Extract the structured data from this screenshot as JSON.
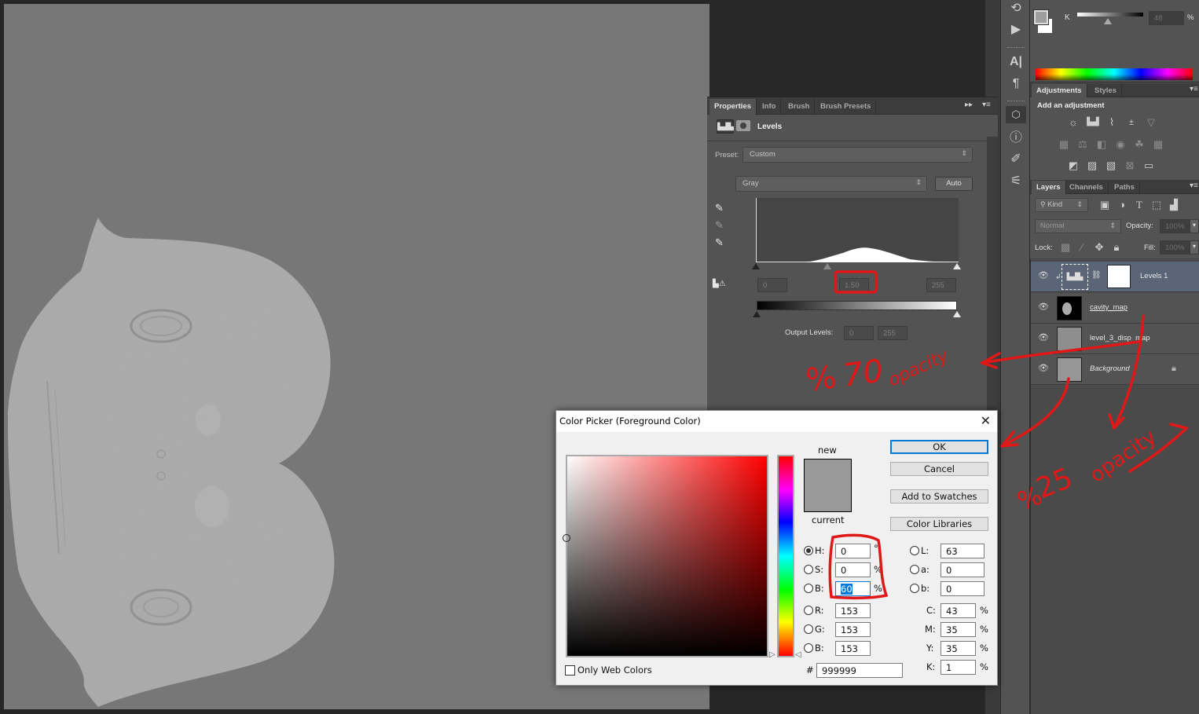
{
  "canvas": {
    "document_description": "Grayscale head displacement/cavity UV map"
  },
  "toolbar_strip": {
    "icons": [
      "history-icon",
      "play-action-icon",
      "character-icon",
      "paragraph-icon",
      "3d-properties-icon",
      "info-icon",
      "brush-presets-icon",
      "tool-presets-icon"
    ]
  },
  "color_panel": {
    "channel_label": "K",
    "k_value": "48",
    "percent": "%",
    "slider_value_percent": 48
  },
  "adjustments_panel": {
    "tabs": [
      "Adjustments",
      "Styles"
    ],
    "active_tab": "Adjustments",
    "heading": "Add an adjustment",
    "icons_row1": [
      "brightness-contrast-icon",
      "levels-icon",
      "curves-icon",
      "exposure-icon",
      "vibrance-icon"
    ],
    "icons_row2": [
      "hue-saturation-icon",
      "color-balance-icon",
      "black-white-icon",
      "photo-filter-icon",
      "channel-mixer-icon",
      "color-lookup-icon"
    ],
    "icons_row3": [
      "invert-icon",
      "posterize-icon",
      "threshold-icon",
      "selective-color-icon",
      "gradient-map-icon"
    ]
  },
  "layers_panel": {
    "tabs": [
      "Layers",
      "Channels",
      "Paths"
    ],
    "active_tab": "Layers",
    "filter_label": "Kind",
    "blend_mode": "Normal",
    "opacity_label": "Opacity:",
    "opacity_value": "100%",
    "lock_label": "Lock:",
    "fill_label": "Fill:",
    "fill_value": "100%",
    "layers": [
      {
        "name": "Levels 1",
        "type": "adjustment",
        "selected": true,
        "visible": true
      },
      {
        "name": "cavity_map",
        "type": "raster",
        "selected": false,
        "visible": true
      },
      {
        "name": "level_3_disp_map",
        "type": "raster",
        "selected": false,
        "visible": true
      },
      {
        "name": "Background",
        "type": "background",
        "selected": false,
        "visible": true,
        "locked": true
      }
    ]
  },
  "properties_panel": {
    "tabs": [
      "Properties",
      "Info",
      "Brush",
      "Brush Presets"
    ],
    "active_tab": "Properties",
    "title": "Levels",
    "preset_label": "Preset:",
    "preset_value": "Custom",
    "channel_value": "Gray",
    "auto_label": "Auto",
    "input_black": "0",
    "input_gamma": "1.50",
    "input_white": "255",
    "output_label": "Output Levels:",
    "output_black": "0",
    "output_white": "255"
  },
  "color_picker": {
    "title": "Color Picker (Foreground Color)",
    "new_label": "new",
    "current_label": "current",
    "new_color": "#999999",
    "current_color": "#999999",
    "buttons": {
      "ok": "OK",
      "cancel": "Cancel",
      "add_swatches": "Add to Swatches",
      "color_libraries": "Color Libraries"
    },
    "hsb": {
      "h_label": "H:",
      "h": "0",
      "h_unit": "°",
      "s_label": "S:",
      "s": "0",
      "s_unit": "%",
      "b_label": "B:",
      "b": "60",
      "b_unit": "%"
    },
    "rgb": {
      "r_label": "R:",
      "r": "153",
      "g_label": "G:",
      "g": "153",
      "b_label": "B:",
      "b": "153"
    },
    "lab": {
      "l_label": "L:",
      "l": "63",
      "a_label": "a:",
      "a": "0",
      "b_label": "b:",
      "b": "0"
    },
    "cmyk": {
      "c_label": "C:",
      "c": "43",
      "m_label": "M:",
      "m": "35",
      "y_label": "Y:",
      "y": "35",
      "k_label": "K:",
      "k": "1",
      "unit": "%"
    },
    "hex_label": "#",
    "hex": "999999",
    "only_web_colors_label": "Only Web Colors",
    "only_web_colors_checked": false,
    "selected_mode": "H"
  },
  "annotations": {
    "color": "#e01818",
    "note_70": "% 70 opacity",
    "note_70_parts": {
      "pct": "%",
      "num": "70",
      "word": "opacity"
    },
    "note_25": "%25 opacity",
    "note_25_parts": {
      "pct": "%",
      "num": "25",
      "word": "opacity"
    }
  }
}
